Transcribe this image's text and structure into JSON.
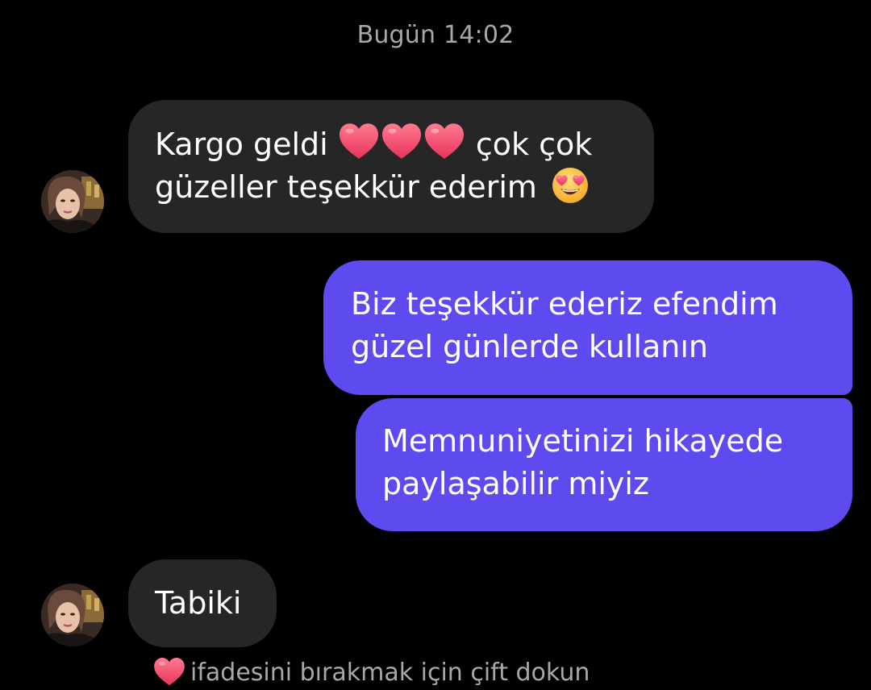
{
  "thread": {
    "date_separator": "Bugün 14:02"
  },
  "messages": [
    {
      "sender": "incoming",
      "lines": [
        "Kargo geldi",
        "çok çok",
        "güzeller teşekkür ederim"
      ],
      "emoji": [
        "red-heart",
        "red-heart",
        "red-heart",
        "heart-eyes"
      ]
    },
    {
      "sender": "outgoing",
      "lines": [
        "Biz teşekkür ederiz efendim",
        "güzel günlerde kullanın"
      ]
    },
    {
      "sender": "outgoing",
      "lines": [
        "Memnuniyetinizi hikayede",
        "paylaşabilir miyiz"
      ]
    },
    {
      "sender": "incoming",
      "lines": [
        "Tabiki"
      ]
    }
  ],
  "reaction_hint": {
    "icon": "red-heart",
    "text": "ifadesini bırakmak için çift dokun"
  },
  "colors": {
    "background": "#000000",
    "incoming_bubble": "#262626",
    "outgoing_bubble": "#5e4bf0",
    "secondary_text": "#a8a8a8",
    "heart": "#f0506e"
  }
}
